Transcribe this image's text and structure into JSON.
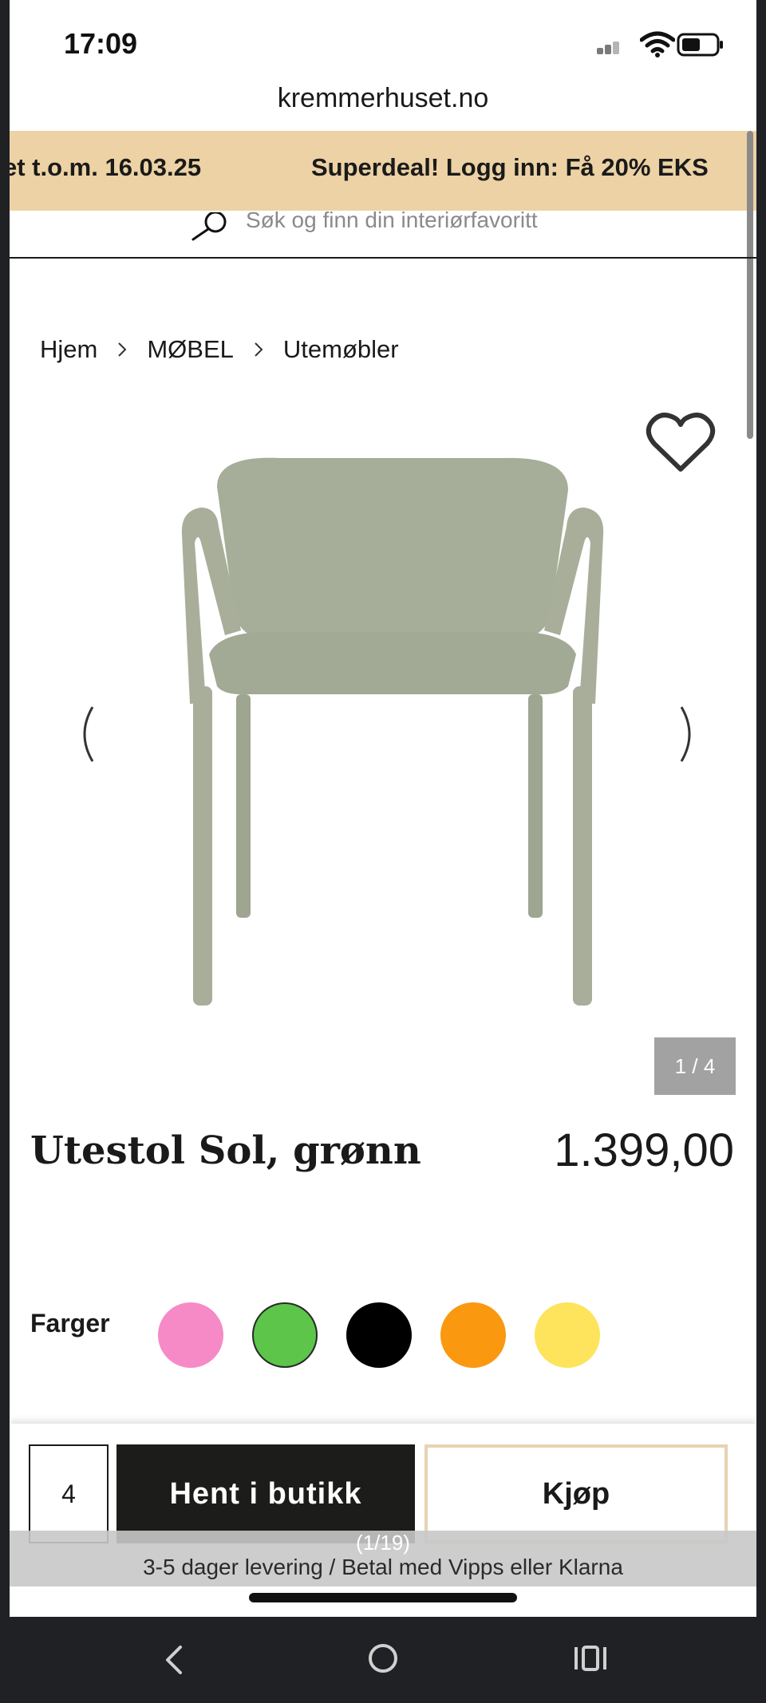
{
  "status_bar": {
    "time": "17:09"
  },
  "browser": {
    "url": "kremmerhuset.no"
  },
  "promo": {
    "text_1": "et t.o.m. 16.03.25",
    "text_2": "Superdeal! Logg inn: Få 20% EKS",
    "color": "#ecd2a4"
  },
  "search": {
    "placeholder": "Søk og finn din interiørfavoritt"
  },
  "breadcrumb": {
    "items": [
      "Hjem",
      "MØBEL",
      "Utemøbler"
    ]
  },
  "gallery": {
    "counter": "1 / 4",
    "icons": [
      "heart-icon",
      "chevron-left-icon",
      "chevron-right-icon"
    ]
  },
  "product": {
    "title": "Utestol Sol, grønn",
    "price": "1.399,00"
  },
  "colors": {
    "label": "Farger",
    "swatches": [
      {
        "name": "pink",
        "hex": "#f68ac7"
      },
      {
        "name": "green",
        "hex": "#5cc54a",
        "selected": true
      },
      {
        "name": "black",
        "hex": "#000000"
      },
      {
        "name": "orange",
        "hex": "#fa980f"
      },
      {
        "name": "yellow",
        "hex": "#fde45c"
      }
    ]
  },
  "purchase": {
    "quantity": "4",
    "store_button": "Hent i butikk",
    "buy_button": "Kjøp",
    "image_index": "(1/19)",
    "delivery_text": "3-5 dager levering / Betal med Vipps eller Klarna"
  },
  "nav": {
    "icons": [
      "back-icon",
      "home-icon",
      "recent-apps-icon"
    ]
  }
}
